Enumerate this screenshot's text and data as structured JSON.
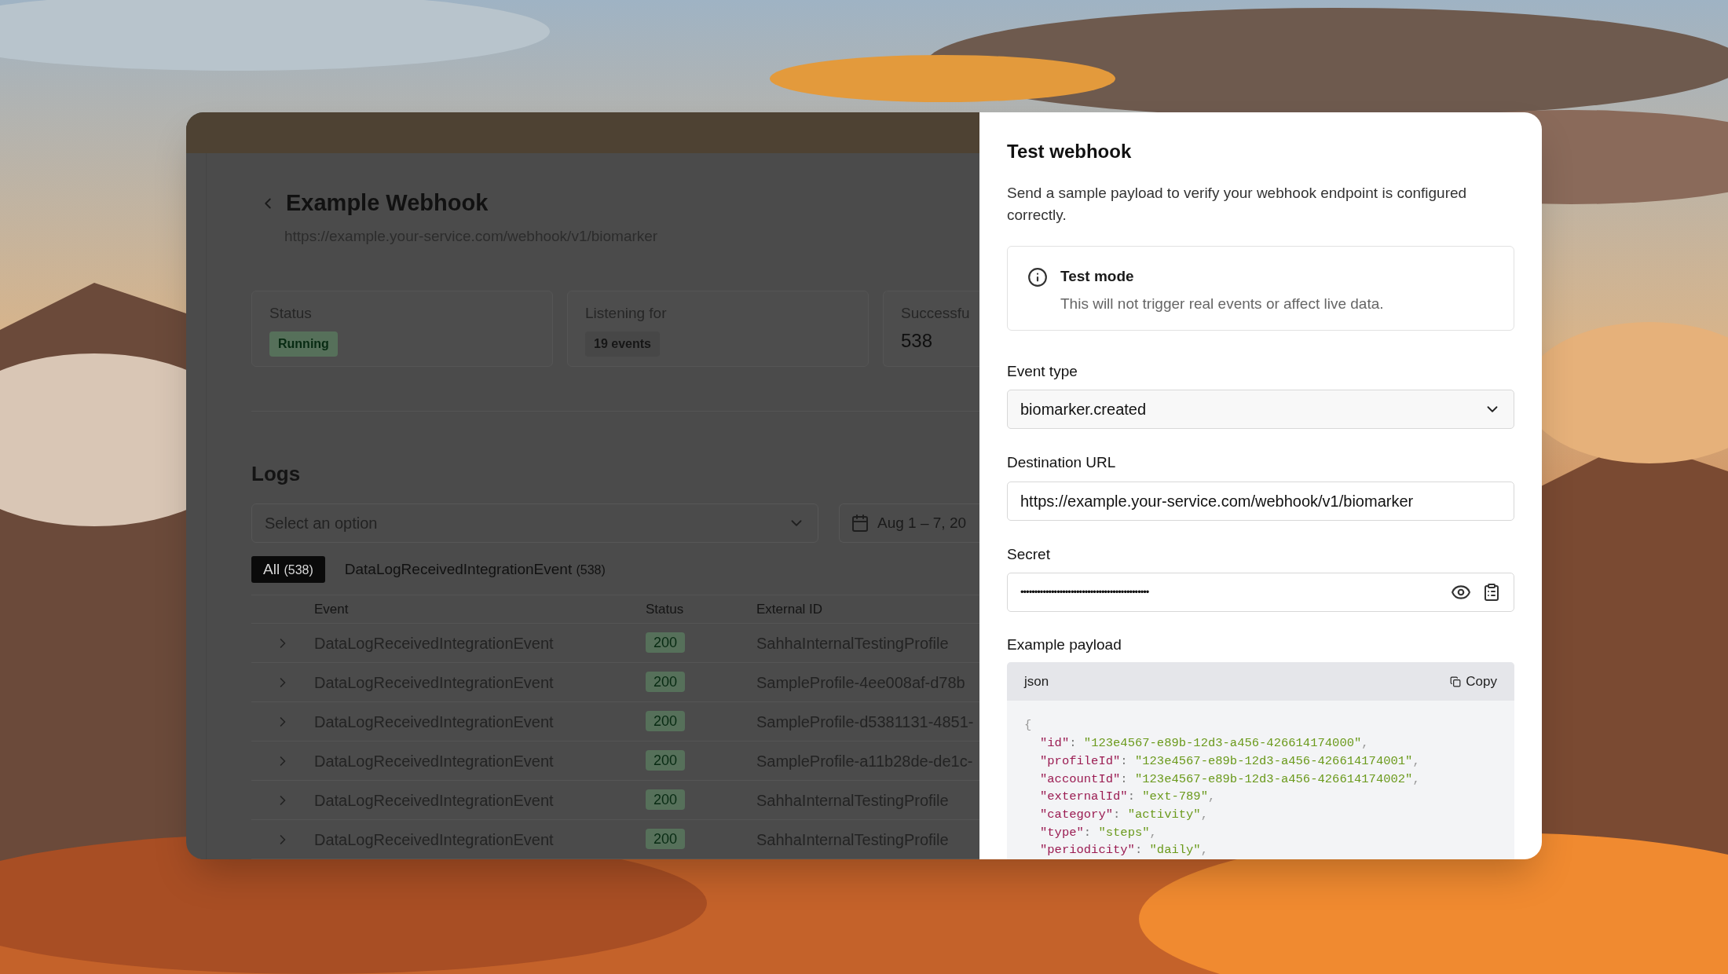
{
  "page": {
    "title": "Example Webhook",
    "url": "https://example.your-service.com/webhook/v1/biomarker"
  },
  "stats": [
    {
      "label": "Status",
      "kind": "success_badge",
      "value": "Running"
    },
    {
      "label": "Listening for",
      "kind": "neutral_badge",
      "value": "19 events"
    },
    {
      "label": "Successfu",
      "kind": "number",
      "value": "538"
    }
  ],
  "logs": {
    "title": "Logs",
    "filter_placeholder": "Select an option",
    "date_range": "Aug 1 – 7, 20",
    "tabs": [
      {
        "label": "All",
        "count": "(538)",
        "selected": true
      },
      {
        "label": "DataLogReceivedIntegrationEvent",
        "count": "(538)",
        "selected": false
      }
    ],
    "columns": [
      "Event",
      "Status",
      "External ID"
    ],
    "rows": [
      {
        "event": "DataLogReceivedIntegrationEvent",
        "status": "200",
        "external_id": "SahhaInternalTestingProfile"
      },
      {
        "event": "DataLogReceivedIntegrationEvent",
        "status": "200",
        "external_id": "SampleProfile-4ee008af-d78b"
      },
      {
        "event": "DataLogReceivedIntegrationEvent",
        "status": "200",
        "external_id": "SampleProfile-d5381131-4851-"
      },
      {
        "event": "DataLogReceivedIntegrationEvent",
        "status": "200",
        "external_id": "SampleProfile-a11b28de-de1c-"
      },
      {
        "event": "DataLogReceivedIntegrationEvent",
        "status": "200",
        "external_id": "SahhaInternalTestingProfile"
      },
      {
        "event": "DataLogReceivedIntegrationEvent",
        "status": "200",
        "external_id": "SahhaInternalTestingProfile"
      }
    ]
  },
  "dialog": {
    "title": "Test webhook",
    "description": "Send a sample payload to verify your webhook endpoint is configured correctly.",
    "notice": {
      "title": "Test mode",
      "text": "This will not trigger real events or affect live data."
    },
    "event_type": {
      "label": "Event type",
      "value": "biomarker.created"
    },
    "destination_url": {
      "label": "Destination URL",
      "value": "https://example.your-service.com/webhook/v1/biomarker"
    },
    "secret": {
      "label": "Secret",
      "value": "••••••••••••••••••••••••••••••••••••••••••••••"
    },
    "payload": {
      "label": "Example payload",
      "language": "json",
      "copy_label": "Copy",
      "lines": [
        {
          "kind": "punct",
          "text": "{"
        },
        {
          "kind": "pair",
          "key": "\"id\"",
          "sep": ": ",
          "value": "\"123e4567-e89b-12d3-a456-426614174000\"",
          "end": ","
        },
        {
          "kind": "pair",
          "key": "\"profileId\"",
          "sep": ": ",
          "value": "\"123e4567-e89b-12d3-a456-426614174001\"",
          "end": ","
        },
        {
          "kind": "pair",
          "key": "\"accountId\"",
          "sep": ": ",
          "value": "\"123e4567-e89b-12d3-a456-426614174002\"",
          "end": ","
        },
        {
          "kind": "pair",
          "key": "\"externalId\"",
          "sep": ": ",
          "value": "\"ext-789\"",
          "end": ","
        },
        {
          "kind": "pair",
          "key": "\"category\"",
          "sep": ": ",
          "value": "\"activity\"",
          "end": ","
        },
        {
          "kind": "pair",
          "key": "\"type\"",
          "sep": ": ",
          "value": "\"steps\"",
          "end": ","
        },
        {
          "kind": "pair",
          "key": "\"periodicity\"",
          "sep": ": ",
          "value": "\"daily\"",
          "end": ","
        }
      ]
    }
  }
}
